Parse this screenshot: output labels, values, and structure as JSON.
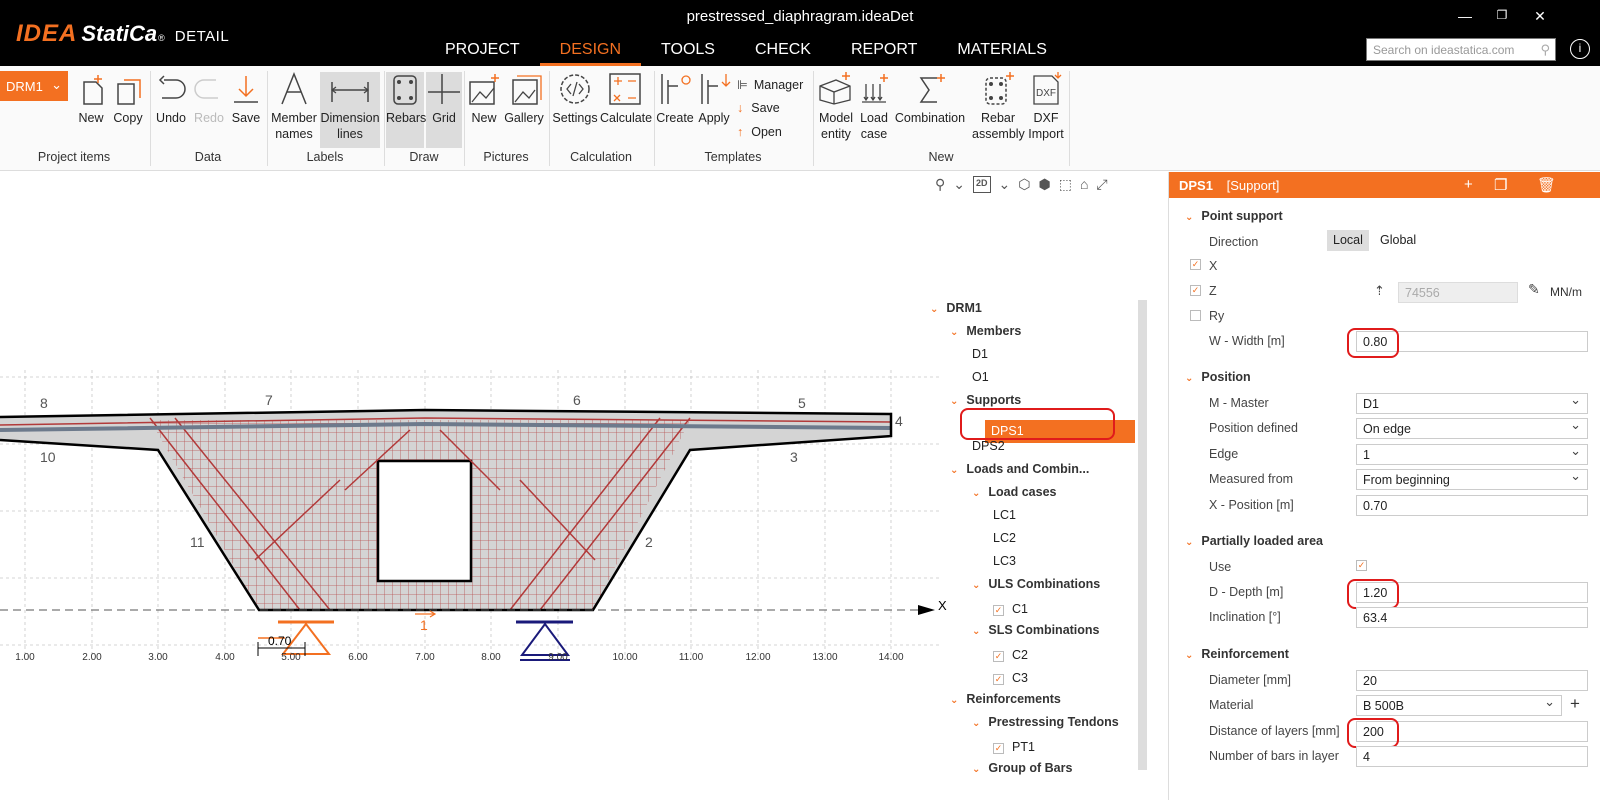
{
  "app": {
    "logo_idea": "IDEA",
    "logo_statica": "StatiCa",
    "logo_reg": "®",
    "product": "DETAIL",
    "document_title": "prestressed_diaphragram.ideaDet",
    "window_controls": {
      "minimize": "—",
      "restore": "❐",
      "close": "✕"
    }
  },
  "nav": {
    "items": [
      "PROJECT",
      "DESIGN",
      "TOOLS",
      "CHECK",
      "REPORT",
      "MATERIALS"
    ],
    "active": "DESIGN"
  },
  "search": {
    "placeholder": "Search on ideastatica.com"
  },
  "help": {
    "label": "i"
  },
  "ribbon": {
    "selector": {
      "value": "DRM1"
    },
    "groups": {
      "project_items": {
        "label": "Project items",
        "new": "New",
        "copy": "Copy"
      },
      "data": {
        "label": "Data",
        "undo": "Undo",
        "redo": "Redo",
        "save": "Save"
      },
      "labels": {
        "label": "Labels",
        "member_names_1": "Member",
        "member_names_2": "names",
        "dimension_lines_1": "Dimension",
        "dimension_lines_2": "lines"
      },
      "draw": {
        "label": "Draw",
        "rebars": "Rebars",
        "grid": "Grid"
      },
      "pictures": {
        "label": "Pictures",
        "new": "New",
        "gallery": "Gallery"
      },
      "calculation": {
        "label": "Calculation",
        "settings": "Settings",
        "calculate": "Calculate"
      },
      "templates": {
        "label": "Templates",
        "create": "Create",
        "apply": "Apply",
        "manager": "Manager",
        "save": "Save",
        "open": "Open"
      },
      "new": {
        "label": "New",
        "model_entity_1": "Model",
        "model_entity_2": "entity",
        "load_case_1": "Load",
        "load_case_2": "case",
        "combination": "Combination",
        "rebar_assembly_1": "Rebar",
        "rebar_assembly_2": "assembly",
        "dxf_import_1": "DXF",
        "dxf_import_2": "Import",
        "dxf_icon_text": "DXF"
      }
    }
  },
  "view_toolbar": {
    "mode": "2D"
  },
  "drawing": {
    "edge_numbers": [
      "8",
      "7",
      "6",
      "5",
      "4",
      "10",
      "3",
      "11",
      "2",
      "1"
    ],
    "axis_label": "X",
    "dimension": "0.70",
    "x_ticks": [
      "1.00",
      "2.00",
      "3.00",
      "4.00",
      "5.00",
      "6.00",
      "7.00",
      "8.00",
      "9.00",
      "10.00",
      "11.00",
      "12.00",
      "13.00",
      "14.00"
    ]
  },
  "tree": {
    "root": "DRM1",
    "members": {
      "label": "Members",
      "items": [
        "D1",
        "O1"
      ]
    },
    "supports": {
      "label": "Supports",
      "items": [
        "DPS1",
        "DPS2"
      ],
      "selected": "DPS1"
    },
    "loads": {
      "label": "Loads and Combin...",
      "load_cases": {
        "label": "Load cases",
        "items": [
          "LC1",
          "LC2",
          "LC3"
        ]
      },
      "uls": {
        "label": "ULS Combinations",
        "items": [
          "C1"
        ]
      },
      "sls": {
        "label": "SLS Combinations",
        "items": [
          "C2",
          "C3"
        ]
      }
    },
    "reinforcements": {
      "label": "Reinforcements",
      "tendons": {
        "label": "Prestressing Tendons",
        "items": [
          "PT1"
        ]
      },
      "group_bars": {
        "label": "Group of Bars"
      }
    }
  },
  "panel": {
    "title": "DPS1",
    "subtitle": "[Support]",
    "point_support": {
      "label": "Point support",
      "direction_label": "Direction",
      "direction_local": "Local",
      "direction_global": "Global",
      "x_label": "X",
      "x_checked": true,
      "z_label": "Z",
      "z_checked": true,
      "z_value": "74556",
      "z_unit": "MN/m",
      "ry_label": "Ry",
      "ry_checked": false,
      "width_label": "W - Width [m]",
      "width_value": "0.80"
    },
    "position": {
      "label": "Position",
      "master_label": "M - Master",
      "master_value": "D1",
      "defined_label": "Position defined",
      "defined_value": "On edge",
      "edge_label": "Edge",
      "edge_value": "1",
      "measured_label": "Measured from",
      "measured_value": "From beginning",
      "xpos_label": "X - Position [m]",
      "xpos_value": "0.70"
    },
    "partial": {
      "label": "Partially loaded area",
      "use_label": "Use",
      "use_checked": true,
      "depth_label": "D - Depth [m]",
      "depth_value": "1.20",
      "incl_label": "Inclination [°]",
      "incl_value": "63.4"
    },
    "reinforcement": {
      "label": "Reinforcement",
      "diameter_label": "Diameter [mm]",
      "diameter_value": "20",
      "material_label": "Material",
      "material_value": "B 500B",
      "distance_label": "Distance of layers [mm]",
      "distance_value": "200",
      "bars_label": "Number of bars in layer",
      "bars_value": "4"
    }
  },
  "colors": {
    "accent": "#f37021",
    "highlight": "#e01b1b",
    "titlebar": "#000000",
    "support_selected": "#f37021",
    "support_other": "#1a1a7a"
  }
}
